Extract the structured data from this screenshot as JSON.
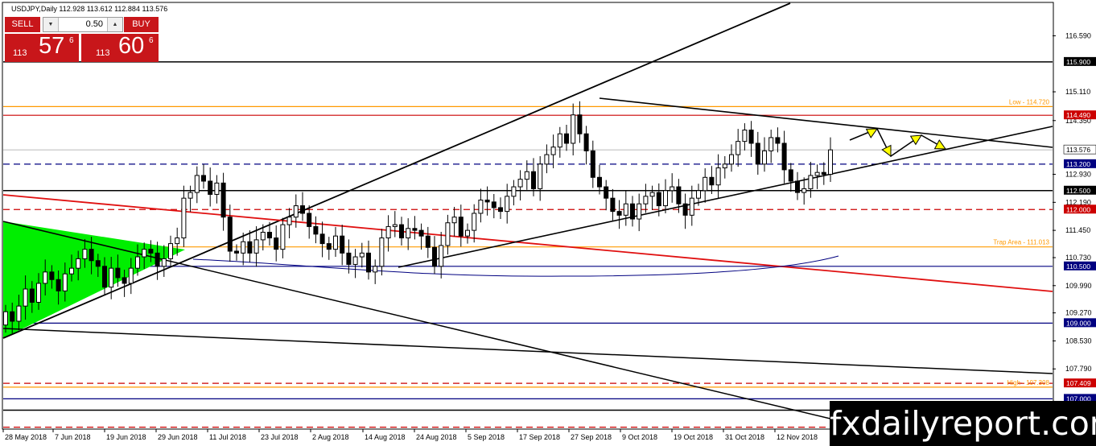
{
  "header": {
    "symbol_line": "USDJPY,Daily  112.928 113.612 112.884 113.576"
  },
  "trade_panel": {
    "sell_label": "SELL",
    "buy_label": "BUY",
    "lot": "0.50",
    "sell": {
      "prefix": "113",
      "big": "57",
      "sup": "6"
    },
    "buy": {
      "prefix": "113",
      "big": "60",
      "sup": "6"
    }
  },
  "watermark": "fxdailyreport.com",
  "chart_data": {
    "type": "candlestick",
    "title": "USDJPY,Daily",
    "ohlc": {
      "open": 112.928,
      "high": 113.612,
      "low": 112.884,
      "close": 113.576
    },
    "ylim": [
      106.2,
      117.45
    ],
    "y_ticks": [
      "116.590",
      "115.110",
      "114.350",
      "112.930",
      "112.190",
      "111.450",
      "110.730",
      "109.990",
      "109.270",
      "108.530",
      "107.790"
    ],
    "x_ticks": [
      "28 May 2018",
      "7 Jun 2018",
      "19 Jun 2018",
      "29 Jun 2018",
      "11 Jul 2018",
      "23 Jul 2018",
      "2 Aug 2018",
      "14 Aug 2018",
      "24 Aug 2018",
      "5 Sep 2018",
      "17 Sep 2018",
      "27 Sep 2018",
      "9 Oct 2018",
      "19 Oct 2018",
      "31 Oct 2018",
      "12 Nov 2018"
    ],
    "closes": [
      109.3,
      109.05,
      109.45,
      109.9,
      109.55,
      110.05,
      110.35,
      110.15,
      109.85,
      110.3,
      110.45,
      110.7,
      110.95,
      110.65,
      110.5,
      109.95,
      110.45,
      110.2,
      110.05,
      110.45,
      110.75,
      110.95,
      110.85,
      110.5,
      110.7,
      111.1,
      111.25,
      112.3,
      112.45,
      112.9,
      112.75,
      112.4,
      112.7,
      111.8,
      110.9,
      110.85,
      111.15,
      110.85,
      111.2,
      111.4,
      111.25,
      110.95,
      111.6,
      111.8,
      112.1,
      111.9,
      111.55,
      111.35,
      111.1,
      110.95,
      111.3,
      110.85,
      110.55,
      110.75,
      110.85,
      110.35,
      110.5,
      111.25,
      111.55,
      111.6,
      111.25,
      111.5,
      111.45,
      111.3,
      111.0,
      110.5,
      111.05,
      111.65,
      111.8,
      111.3,
      111.45,
      111.9,
      112.25,
      112.2,
      112.05,
      111.95,
      112.35,
      112.6,
      112.8,
      113.0,
      112.55,
      113.2,
      113.45,
      113.65,
      114.0,
      113.75,
      114.5,
      114.0,
      113.55,
      112.85,
      112.6,
      112.3,
      111.95,
      111.85,
      112.15,
      111.75,
      112.15,
      112.35,
      112.45,
      112.1,
      112.5,
      112.6,
      112.15,
      111.85,
      112.3,
      112.5,
      112.85,
      112.65,
      113.1,
      113.2,
      113.45,
      113.8,
      114.1,
      113.75,
      113.2,
      113.55,
      113.9,
      113.75,
      113.05,
      112.75,
      112.45,
      112.55,
      112.9,
      112.98,
      112.93,
      113.576
    ],
    "levels": [
      {
        "label": "115.900",
        "value": 115.9,
        "color": "#000000",
        "style": "solid"
      },
      {
        "label": "Low - 114.720",
        "value": 114.72,
        "color": "#ff9900",
        "style": "solid"
      },
      {
        "label": "114.490",
        "value": 114.49,
        "color": "#cc0000",
        "style": "solid"
      },
      {
        "label": "113.576",
        "value": 113.576,
        "color": "#c0c0c0",
        "style": "solid"
      },
      {
        "label": "113.200",
        "value": 113.2,
        "color": "#000080",
        "style": "dash"
      },
      {
        "label": "112.500",
        "value": 112.5,
        "color": "#000000",
        "style": "solid"
      },
      {
        "label": "112.000",
        "value": 112.0,
        "color": "#cc0000",
        "style": "dash"
      },
      {
        "label": "Trap Area - 111.013",
        "value": 111.013,
        "color": "#ff9900",
        "style": "solid"
      },
      {
        "label": "110.500",
        "value": 110.5,
        "color": "#000080",
        "style": "solid"
      },
      {
        "label": "109.000",
        "value": 109.0,
        "color": "#000080",
        "style": "solid"
      },
      {
        "label": "107.409",
        "value": 107.409,
        "color": "#cc0000",
        "style": "dash"
      },
      {
        "label": "High - 107.308",
        "value": 107.308,
        "color": "#ff9900",
        "style": "solid"
      },
      {
        "label": "107.000",
        "value": 107.0,
        "color": "#000080",
        "style": "solid"
      },
      {
        "label": "106.700",
        "value": 106.7,
        "color": "#000000",
        "style": "solid"
      },
      {
        "label": "106.250",
        "value": 106.25,
        "color": "#cc0000",
        "style": "dash"
      }
    ]
  }
}
